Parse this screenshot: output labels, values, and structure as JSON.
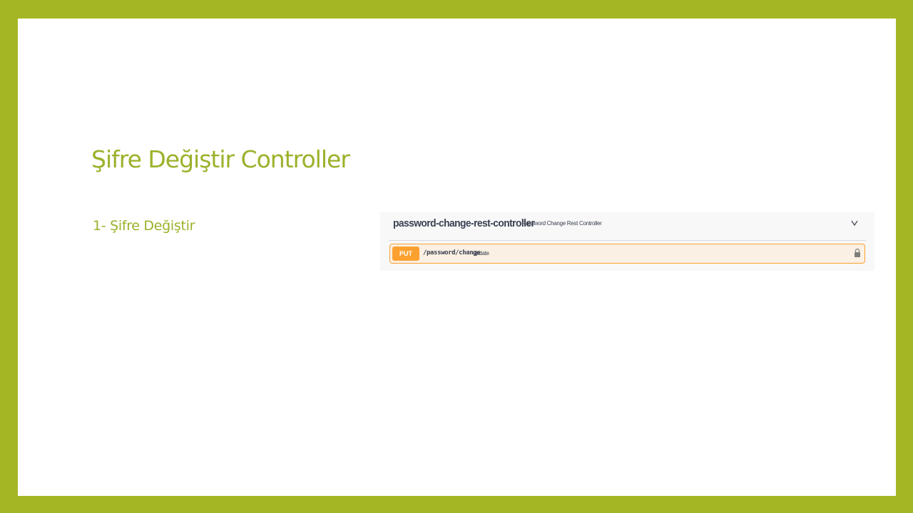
{
  "slide": {
    "title": "Şifre Değiştir Controller",
    "bullet": "1- Şifre Değiştir"
  },
  "swagger": {
    "tag_name": "password-change-rest-controller",
    "tag_description": "Password Change Rest Controller",
    "expand_icon": "chevron-down-icon",
    "operation": {
      "method": "PUT",
      "path": "/password/change",
      "summary": "update",
      "auth_icon": "lock-icon"
    }
  },
  "colors": {
    "frame": "#a5b625",
    "title": "#9db02a",
    "put_method": "#fca130",
    "put_background": "#faf0e3"
  }
}
